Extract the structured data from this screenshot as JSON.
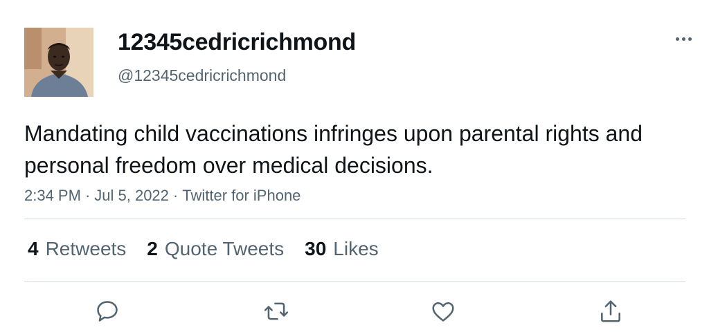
{
  "user": {
    "display_name": "12345cedricrichmond",
    "handle": "@12345cedricrichmond"
  },
  "tweet": {
    "text": "Mandating child vaccinations infringes upon parental rights and personal freedom over medical decisions.",
    "time": "2:34 PM",
    "date": "Jul 5, 2022",
    "source": "Twitter for iPhone",
    "separator": "·"
  },
  "stats": {
    "retweets": {
      "count": "4",
      "label": "Retweets"
    },
    "quotes": {
      "count": "2",
      "label": "Quote Tweets"
    },
    "likes": {
      "count": "30",
      "label": "Likes"
    }
  },
  "actions": [
    "reply-icon",
    "retweet-icon",
    "like-icon",
    "share-icon"
  ],
  "colors": {
    "text_primary": "#0f1419",
    "text_secondary": "#536471",
    "divider": "#cfd9de"
  }
}
